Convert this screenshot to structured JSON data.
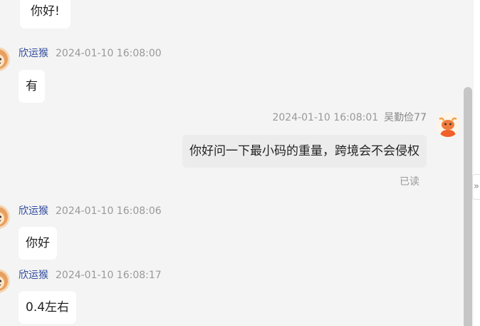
{
  "messages": [
    {
      "text": "你好!"
    },
    {
      "sender": "欣运猴",
      "time": "2024-01-10 16:08:00",
      "text": "有"
    },
    {
      "sender": "吴勤俭77",
      "time": "2024-01-10 16:08:01",
      "text": "你好问一下最小码的重量，跨境会不会侵权",
      "status": "已读"
    },
    {
      "sender": "欣运猴",
      "time": "2024-01-10 16:08:06",
      "text": "你好"
    },
    {
      "sender": "欣运猴",
      "time": "2024-01-10 16:08:17",
      "text": "0.4左右"
    }
  ],
  "panel_toggle": {
    "icon": "double-chevron-right-icon",
    "glyph": "»"
  },
  "colors": {
    "background": "#f4f4f4",
    "bubble_incoming": "#ffffff",
    "bubble_outgoing": "#ececec",
    "sender_name": "#2f4a9c",
    "timestamp": "#999999",
    "scrollbar_thumb": "#c6c6c6"
  }
}
